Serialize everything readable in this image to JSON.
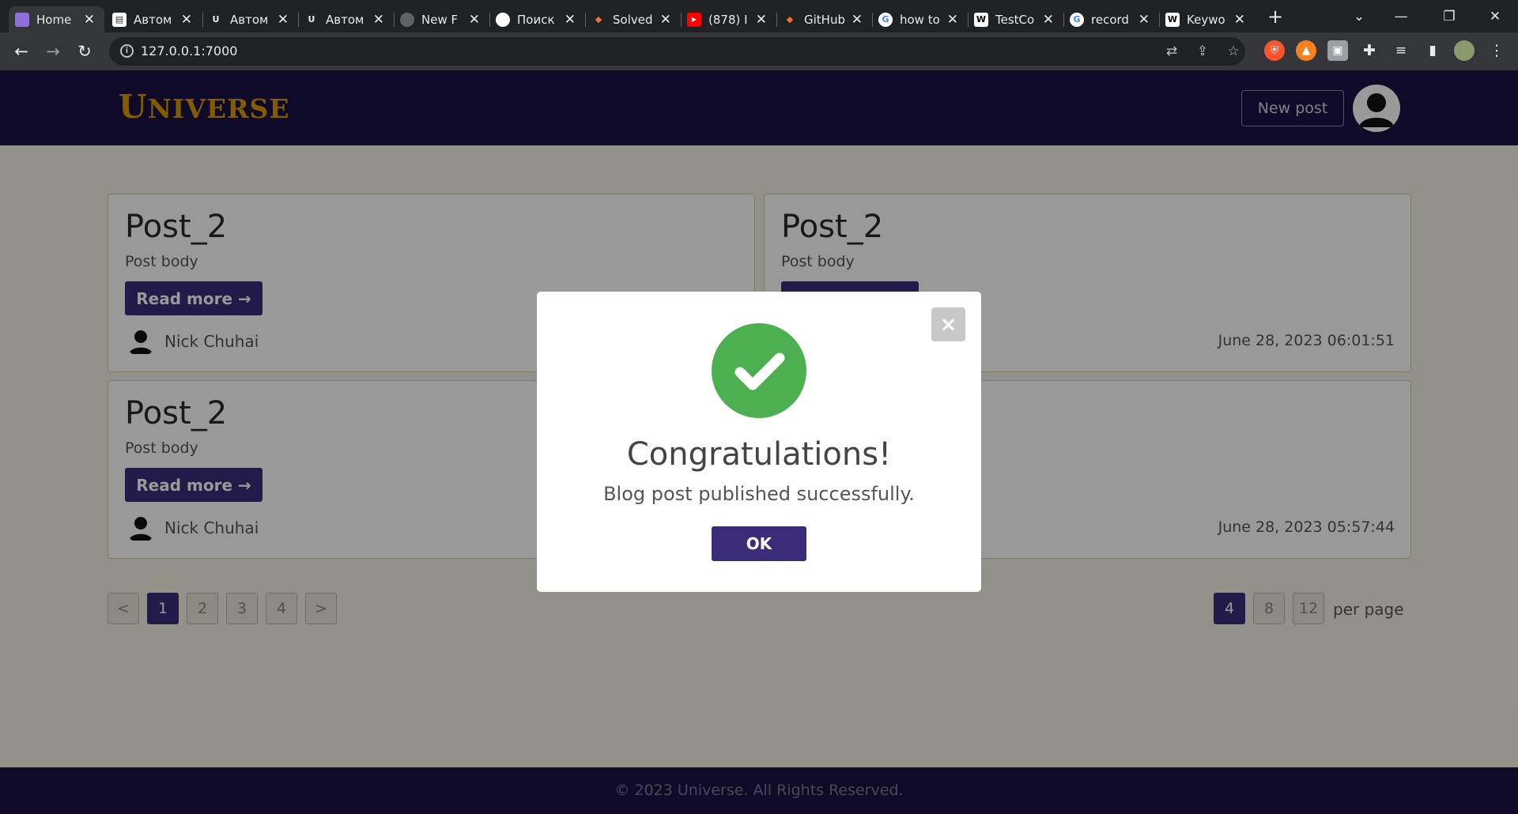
{
  "browser": {
    "tabs": [
      {
        "title": "Home",
        "favicon": "universe-favicon",
        "color": "#8e6fd8"
      },
      {
        "title": "Автом",
        "favicon": "doc-favicon",
        "color": "#ffffff"
      },
      {
        "title": "Автом",
        "favicon": "umx-favicon",
        "color": "#ffffff"
      },
      {
        "title": "Автом",
        "favicon": "umx-favicon",
        "color": "#ffffff"
      },
      {
        "title": "New F",
        "favicon": "github-favicon",
        "color": "#5f6368"
      },
      {
        "title": "Поиск",
        "favicon": "github-favicon",
        "color": "#ffffff"
      },
      {
        "title": "Solved",
        "favicon": "gitlab-favicon",
        "color": "#e8742c"
      },
      {
        "title": "(878) I",
        "favicon": "youtube-favicon",
        "color": "#ff0000"
      },
      {
        "title": "GitHub",
        "favicon": "gitlab-favicon",
        "color": "#e8742c"
      },
      {
        "title": "how to",
        "favicon": "google-favicon",
        "color": "#ffffff"
      },
      {
        "title": "TestCo",
        "favicon": "wikipedia-favicon",
        "color": "#ffffff"
      },
      {
        "title": "record",
        "favicon": "google-favicon",
        "color": "#ffffff"
      },
      {
        "title": "Keywo",
        "favicon": "wikipedia-favicon",
        "color": "#ffffff"
      }
    ],
    "url": "127.0.0.1:7000"
  },
  "site": {
    "logo_first": "U",
    "logo_rest": "NIVERSE",
    "new_post_label": "New post"
  },
  "posts": [
    {
      "title": "Post_2",
      "body": "Post body",
      "read_more": "Read more →",
      "author": "Nick Chuhai",
      "date": ""
    },
    {
      "title": "Post_2",
      "body": "Post body",
      "read_more": "Read more →",
      "author": "",
      "date": "June 28, 2023 06:01:51"
    },
    {
      "title": "Post_2",
      "body": "Post body",
      "read_more": "Read more →",
      "author": "Nick Chuhai",
      "date": ""
    },
    {
      "title": "",
      "body": "",
      "read_more": "",
      "author": "",
      "date": "June 28, 2023 05:57:44"
    }
  ],
  "pagination": {
    "prev": "<",
    "pages": [
      "1",
      "2",
      "3",
      "4"
    ],
    "next": ">",
    "current": "1"
  },
  "per_page": {
    "options": [
      "4",
      "8",
      "12"
    ],
    "selected": "4",
    "label": "per page"
  },
  "footer": {
    "text": "© 2023 Universe. All Rights Reserved."
  },
  "modal": {
    "close": "×",
    "title": "Congratulations!",
    "message": "Blog post published successfully.",
    "ok_label": "OK"
  },
  "colors": {
    "header_bg": "#1a1142",
    "accent": "#3a2c78",
    "success": "#4caf50",
    "logo": "#d99a00"
  }
}
